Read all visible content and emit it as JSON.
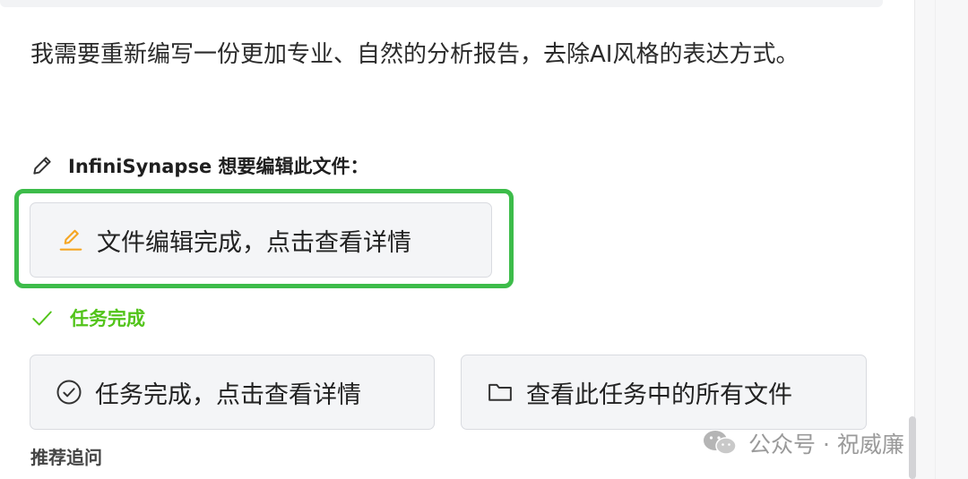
{
  "message": {
    "text": "我需要重新编写一份更加专业、自然的分析报告，去除AI风格的表达方式。"
  },
  "editor": {
    "label": "InfiniSynapse 想要编辑此文件："
  },
  "edit_button": {
    "label": "文件编辑完成，点击查看详情",
    "icon": "edit-pencil-icon"
  },
  "status": {
    "text": "任务完成",
    "icon": "checkmark-icon",
    "color": "#52c41a"
  },
  "task_button": {
    "label": "任务完成，点击查看详情",
    "icon": "check-circle-icon"
  },
  "files_button": {
    "label": "查看此任务中的所有文件",
    "icon": "folder-icon"
  },
  "recommended": {
    "heading": "推荐追问"
  },
  "watermark": {
    "text": "公众号 · 祝威廉",
    "icon": "wechat-icon"
  },
  "colors": {
    "highlight": "#3dbc4a",
    "accent_orange": "#f5a623",
    "success": "#52c41a"
  }
}
